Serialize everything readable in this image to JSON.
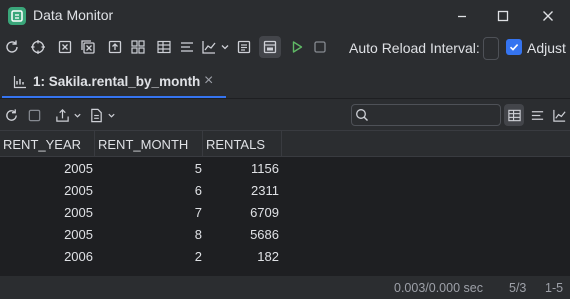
{
  "window": {
    "title": "Data Monitor",
    "controls": [
      "minimize",
      "maximize",
      "close"
    ]
  },
  "toolbar": {
    "buttons": [
      "refresh-icon",
      "target-icon",
      "clear-icon",
      "clear-all-icon",
      "export-icon",
      "layout-icon",
      "table-icon",
      "align-icon",
      "chart-icon",
      "dropdown-icon",
      "text-icon",
      "panel-icon",
      "run-icon",
      "stop-icon"
    ],
    "auto_reload_label": "Auto Reload Interval:",
    "adjust_label": "Adjust",
    "adjust_checked": true
  },
  "tab": {
    "label": "1: Sakila.rental_by_month",
    "close_glyph": "×"
  },
  "grid_toolbar": {
    "search_placeholder": ""
  },
  "table": {
    "columns": [
      "RENT_YEAR",
      "RENT_MONTH",
      "RENTALS"
    ],
    "rows": [
      [
        "2005",
        "5",
        "1156"
      ],
      [
        "2005",
        "6",
        "2311"
      ],
      [
        "2005",
        "7",
        "6709"
      ],
      [
        "2005",
        "8",
        "5686"
      ],
      [
        "2006",
        "2",
        "182"
      ]
    ]
  },
  "status": {
    "timing": "0.003/0.000 sec",
    "position": "5/3",
    "range": "1-5"
  }
}
